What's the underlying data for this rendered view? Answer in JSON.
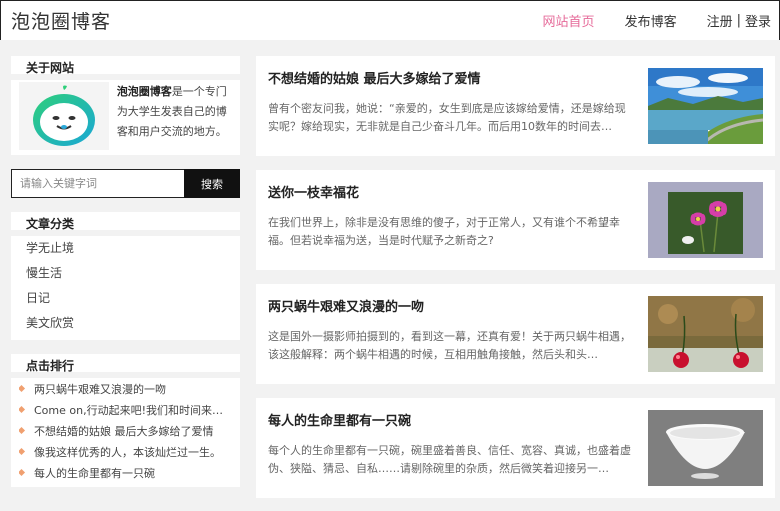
{
  "header": {
    "brand": "泡泡圈博客",
    "nav": {
      "home": "网站首页",
      "publish": "发布博客",
      "register": "注册",
      "separator": "|",
      "login": "登录"
    },
    "accent_color": "#e66b9a"
  },
  "sidebar": {
    "about": {
      "title": "关于网站",
      "name": "泡泡圈博客",
      "desc": "是一个专门为大学生发表自己的博客和用户交流的地方。"
    },
    "search": {
      "placeholder": "请输入关键字词",
      "button": "搜索"
    },
    "categories": {
      "title": "文章分类",
      "items": [
        "学无止境",
        "慢生活",
        "日记",
        "美文欣赏"
      ]
    },
    "ranking": {
      "title": "点击排行",
      "items": [
        "两只蜗牛艰难又浪漫的一吻",
        "Come on,行动起来吧!我们和时间来…",
        "不想结婚的姑娘 最后大多嫁给了爱情",
        "像我这样优秀的人，本该灿烂过一生。",
        "每人的生命里都有一只碗"
      ]
    }
  },
  "posts": [
    {
      "title": "不想结婚的姑娘 最后大多嫁给了爱情",
      "excerpt": "曾有个密友问我，她说：“亲爱的，女生到底是应该嫁给爱情，还是嫁给现实呢？嫁给现实，无非就是自己少奋斗几年。而后用10数年的时间去…",
      "thumb": "landscape-lake-image"
    },
    {
      "title": "送你一枝幸福花",
      "excerpt": "在我们世界上，除非是没有思维的傻子，对于正常人，又有谁个不希望幸福。但若说幸福为送，当是时代赋予之新奇之?",
      "thumb": "pink-flower-image"
    },
    {
      "title": "两只蜗牛艰难又浪漫的一吻",
      "excerpt": "这是国外一摄影师拍摄到的，看到这一幕，还真有爱！关于两只蜗牛相遇，该这般解释：两个蜗牛相遇的时候，互相用触角接触，然后头和头…",
      "thumb": "cherries-image"
    },
    {
      "title": "每人的生命里都有一只碗",
      "excerpt": "每个人的生命里都有一只碗，碗里盛着善良、信任、宽容、真诚，也盛着虚伪、狭隘、猜忌、自私……请剔除碗里的杂质，然后微笑着迎接另一…",
      "thumb": "white-bowl-image"
    }
  ]
}
